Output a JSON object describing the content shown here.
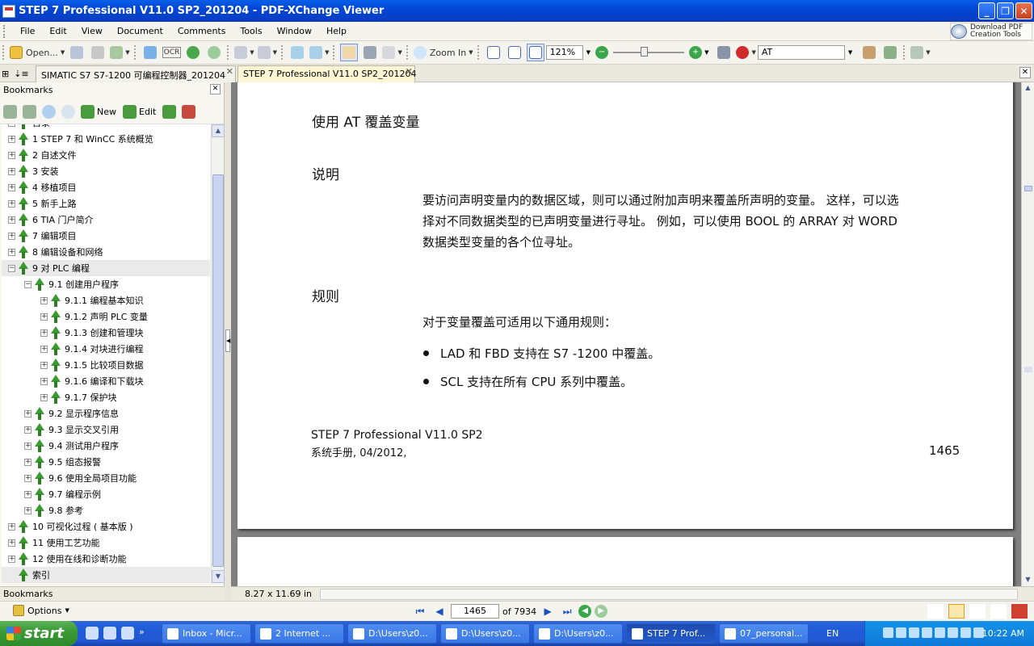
{
  "window": {
    "title": "STEP 7 Professional V11.0 SP2_201204 - PDF-XChange Viewer"
  },
  "menu": [
    "File",
    "Edit",
    "View",
    "Document",
    "Comments",
    "Tools",
    "Window",
    "Help"
  ],
  "promo": {
    "text": "Download PDF\nCreation Tools"
  },
  "toolbar": {
    "open_label": "Open...",
    "zoom_in_label": "Zoom In",
    "zoom_value": "121%",
    "search_value": "AT",
    "ocr_label": "OCR"
  },
  "tabs": [
    {
      "label": "SIMATIC S7 S7-1200 可编程控制器_201204"
    },
    {
      "label": "STEP 7 Professional V11.0 SP2_201204"
    }
  ],
  "bookmarks": {
    "title": "Bookmarks",
    "new_label": "New",
    "edit_label": "Edit",
    "items": [
      {
        "label": "目录",
        "level": 0
      },
      {
        "label": "1 STEP 7 和 WinCC 系统概览",
        "level": 0
      },
      {
        "label": "2 自述文件",
        "level": 0
      },
      {
        "label": "3 安装",
        "level": 0
      },
      {
        "label": "4 移植项目",
        "level": 0
      },
      {
        "label": "5 新手上路",
        "level": 0
      },
      {
        "label": "6 TIA 门户简介",
        "level": 0
      },
      {
        "label": "7 编辑项目",
        "level": 0
      },
      {
        "label": "8 编辑设备和网络",
        "level": 0
      },
      {
        "label": "9 对 PLC 编程",
        "level": 0
      },
      {
        "label": "9.1 创建用户程序",
        "level": 1
      },
      {
        "label": "9.1.1 编程基本知识",
        "level": 2
      },
      {
        "label": "9.1.2 声明 PLC 变量",
        "level": 2
      },
      {
        "label": "9.1.3 创建和管理块",
        "level": 2
      },
      {
        "label": "9.1.4 对块进行编程",
        "level": 2
      },
      {
        "label": "9.1.5 比较项目数据",
        "level": 2
      },
      {
        "label": "9.1.6 编译和下载块",
        "level": 2
      },
      {
        "label": "9.1.7 保护块",
        "level": 2
      },
      {
        "label": "9.2 显示程序信息",
        "level": 1
      },
      {
        "label": "9.3 显示交叉引用",
        "level": 1
      },
      {
        "label": "9.4 测试用户程序",
        "level": 1
      },
      {
        "label": "9.5 组态报警",
        "level": 1
      },
      {
        "label": "9.6 使用全局项目功能",
        "level": 1
      },
      {
        "label": "9.7 编程示例",
        "level": 1
      },
      {
        "label": "9.8 参考",
        "level": 1
      },
      {
        "label": "10 可视化过程 ( 基本版 )",
        "level": 0
      },
      {
        "label": "11 使用工艺功能",
        "level": 0
      },
      {
        "label": "12 使用在线和诊断功能",
        "level": 0
      },
      {
        "label": "索引",
        "level": 0
      }
    ],
    "footer": "Bookmarks"
  },
  "document": {
    "heading": "使用 AT 覆盖变量",
    "section1_title": "说明",
    "section1_lines": [
      "要访问声明变量内的数据区域，则可以通过附加声明来覆盖所声明的变量。 这样，可以选",
      "择对不同数据类型的已声明变量进行寻址。 例如，可以使用 BOOL 的 ARRAY 对 WORD",
      "数据类型变量的各个位寻址。"
    ],
    "section2_title": "规则",
    "section2_intro": "对于变量覆盖可适用以下通用规则：",
    "bullets": [
      "LAD 和 FBD 支持在 S7 -1200 中覆盖。",
      "SCL 支持在所有 CPU 系列中覆盖。"
    ],
    "footer_title": "STEP 7 Professional V11.0 SP2",
    "footer_sub": "系统手册, 04/2012,",
    "page_number": "1465"
  },
  "status": {
    "page_size": "8.27 x 11.69 in"
  },
  "nav": {
    "options_label": "Options",
    "current_page": "1465",
    "total_label": "of 7934"
  },
  "taskbar": {
    "start_label": "start",
    "tasks": [
      "Inbox - Micr...",
      "2 Internet ...",
      "D:\\Users\\z0...",
      "D:\\Users\\z0...",
      "D:\\Users\\z0...",
      "STEP 7 Prof...",
      "07_personal..."
    ],
    "lang": "EN",
    "clock": "10:22 AM"
  }
}
